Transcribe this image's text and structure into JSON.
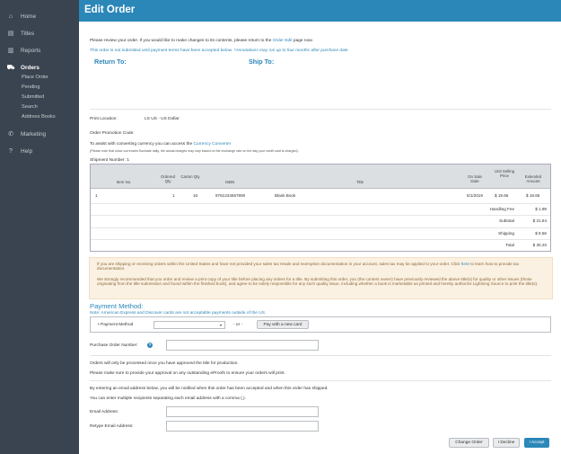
{
  "sidebar": {
    "items": [
      {
        "label": "Home",
        "icon": "home-icon"
      },
      {
        "label": "Titles",
        "icon": "book-icon"
      },
      {
        "label": "Reports",
        "icon": "chart-icon"
      },
      {
        "label": "Orders",
        "icon": "truck-icon"
      },
      {
        "label": "Marketing",
        "icon": "megaphone-icon"
      },
      {
        "label": "Help",
        "icon": "question-icon"
      }
    ],
    "order_sub": [
      "Place Order",
      "Pending",
      "Submitted",
      "Search",
      "Address Books"
    ]
  },
  "header": {
    "title": "Edit Order"
  },
  "intro": {
    "line1_prefix": "Please review your order. If you would like to make changes to its contents, please return to the ",
    "line1_link": "Order Edit",
    "line1_suffix": " page now.",
    "line2": "This order is not submitted until payment terms have been accepted below. ",
    "line2_note": "*Annotations may run up to four months after purchase date"
  },
  "addresses": {
    "return_to": "Return To:",
    "ship_to": "Ship To:"
  },
  "print": {
    "label": "Print Location:",
    "value": "LS US - US Dollar"
  },
  "promo": {
    "label": "Order Promotion Code:"
  },
  "currency": {
    "prefix": "To assist with converting currency you can access the ",
    "link": "Currency Converter",
    "note": "(Please note that since currencies fluctuate daily, the actual charges may vary based on the exchange rate on the day your credit card is charged)."
  },
  "shipment": {
    "label": "Shipment Number:",
    "value": "1"
  },
  "table": {
    "headers": {
      "item": "Item No.",
      "ordered": "Ordered Qty",
      "carton": "Carton Qty",
      "isbn": "ISBN",
      "title": "Title",
      "onsale": "On Sale Date",
      "unit": "Unit Selling Price",
      "extended": "Extended Amount"
    },
    "row": {
      "item": "1",
      "ordered": "1",
      "carton": "16",
      "isbn": "9781234567890",
      "title": "Blank Book",
      "onsale": "5/1/2019",
      "unit": "$ 19.65",
      "extended": "$ 19.65"
    },
    "summary": [
      {
        "label": "Handling Fee",
        "value": "$ 1.99"
      },
      {
        "label": "Subtotal",
        "value": "$ 21.64"
      },
      {
        "label": "Shipping",
        "value": "$ 8.56"
      },
      {
        "label": "Total",
        "value": "$ 30.20"
      }
    ]
  },
  "notice": {
    "p1_prefix": "If you are shipping or receiving orders within the United States and have not provided your sales tax resale and exemption documentation in your account, sales tax may be applied to your order. Click ",
    "p1_link": "here",
    "p1_suffix": " to learn how to provide tax documentation.",
    "p2": "We strongly recommended that you order and review a print copy of your title before placing any orders for a title. By submitting this order, you (the content owner) have previously reviewed the above title(s) for quality or other issues (those originating from the title submission and found within the finished book), and agree to be solely responsible for any such quality issue, including whether a book is marketable as printed and hereby authorize Lightning Source to print the title(s)."
  },
  "payment": {
    "heading": "Payment Method:",
    "note": "Note: American Express and Discover cards are not acceptable payments outside of the US.",
    "label": "• Payment Method",
    "select_value": "",
    "or": "- or -",
    "new_card_button": "Pay with a new card"
  },
  "po": {
    "label": "Purchase Order Number:",
    "help": "?",
    "value": ""
  },
  "processing": {
    "line1": "Orders will only be processed once you have approved the title for production.",
    "line2": "Please make sure to provide your approval on any outstanding eProofs to ensure your orders will print."
  },
  "email": {
    "line1": "By entering an email address below, you will be notified when this order has been accepted and when this order has shipped.",
    "line2": "You can enter multiple recipients separating each email address with a comma (,).",
    "label1": "Email Address:",
    "label2": "Retype Email Address:",
    "value1": "",
    "value2": ""
  },
  "buttons": {
    "change": "Change Order",
    "decline": "I Decline",
    "accept": "I Accept"
  },
  "colors": {
    "sidebar": "#3a4450",
    "header": "#2b87b8",
    "accent": "#2b87b8",
    "notice_bg": "#fbf1e3"
  }
}
